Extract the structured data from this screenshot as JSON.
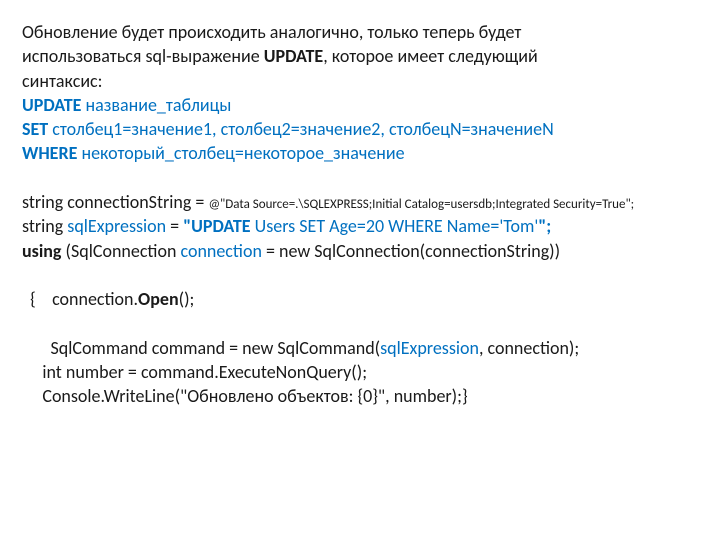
{
  "intro": {
    "l1a": "Обновление будет происходить аналогично, только теперь будет",
    "l2a": "использоваться sql-выражение ",
    "l2b": "UPDATE",
    "l2c": ", которое имеет следующий",
    "l3": "синтаксис:"
  },
  "syntax": {
    "update_kw": "UPDATE",
    "update_rest": " название_таблицы",
    "set_kw": "SET",
    "set_rest": " столбец1=значение1, столбец2=значение2, столбецN=значениеN",
    "where_kw": "WHERE",
    "where_rest": " некоторый_столбец=некоторое_значение"
  },
  "code": {
    "cs_lead": "string connectionString = ",
    "cs_at": "@\"Data Source=.\\SQLEXPRESS;Initial Catalog=usersdb;Integrated Security=True\";",
    "se_lead": " string ",
    "se_var": "sqlExpression",
    "se_eq": " = ",
    "se_q1": "\"",
    "se_upd": "UPDATE",
    "se_rest": " Users SET Age=20 WHERE Name='Tom'",
    "se_q2": "\";",
    "using_kw": "using",
    "using_l": " (SqlConnection ",
    "using_conn": "connection",
    "using_r": " = new SqlConnection(connectionString))",
    "brace_open": "{    connection.",
    "open_m": "Open",
    "open_p": "();",
    "cmd_l": "     SqlCommand command = new SqlCommand(",
    "cmd_arg": "sqlExpression",
    "cmd_r": ", connection);",
    "num_line": "     int number = command.ExecuteNonQuery();",
    "cw_line": "     Console.WriteLine(\"Обновлено объектов: {0}\", number);}"
  }
}
